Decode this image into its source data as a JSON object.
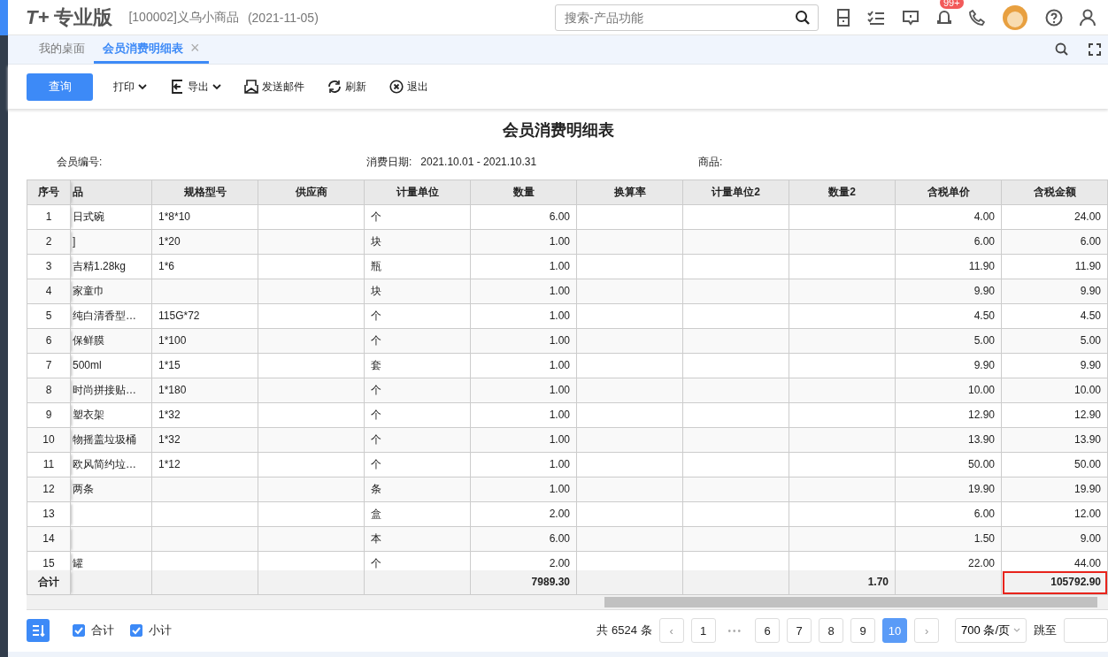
{
  "header": {
    "logo": "T+",
    "edition": "专业版",
    "company": "[100002]义乌小商品",
    "date": "(2021-11-05)",
    "search": {
      "placeholder": "搜索-产品功能"
    },
    "badge": "99+"
  },
  "tabs": [
    {
      "label": "我的桌面",
      "selected": false,
      "closable": false
    },
    {
      "label": "会员消费明细表",
      "selected": true,
      "closable": true
    }
  ],
  "close_glyph": "×",
  "toolbar": {
    "query": "查询",
    "actions": [
      {
        "kind": "print",
        "label": "打印",
        "dropdown": true
      },
      {
        "kind": "export",
        "label": "导出",
        "dropdown": true
      },
      {
        "kind": "mail",
        "label": "发送邮件",
        "dropdown": false
      },
      {
        "kind": "refresh",
        "label": "刷新",
        "dropdown": false
      },
      {
        "kind": "exit",
        "label": "退出",
        "dropdown": false
      }
    ]
  },
  "report": {
    "title": "会员消费明细表",
    "filters": [
      {
        "label": "会员编号:"
      },
      {
        "label": "消费日期:",
        "value": "2021.10.01 - 2021.10.31"
      },
      {
        "label": "商品:"
      }
    ]
  },
  "table": {
    "columns": [
      {
        "label": "序号"
      },
      {
        "label": "品"
      },
      {
        "label": "规格型号"
      },
      {
        "label": "供应商"
      },
      {
        "label": "计量单位"
      },
      {
        "label": "数量"
      },
      {
        "label": "换算率"
      },
      {
        "label": "计量单位2"
      },
      {
        "label": "数量2"
      },
      {
        "label": "含税单价"
      },
      {
        "label": "含税金额"
      }
    ],
    "rows": [
      [
        "1",
        "日式碗",
        "1*8*10",
        "",
        "个",
        "6.00",
        "",
        "",
        "",
        "4.00",
        "24.00"
      ],
      [
        "2",
        "]",
        "1*20",
        "",
        "块",
        "1.00",
        "",
        "",
        "",
        "6.00",
        "6.00"
      ],
      [
        "3",
        "吉精1.28kg",
        "1*6",
        "",
        "瓶",
        "1.00",
        "",
        "",
        "",
        "11.90",
        "11.90"
      ],
      [
        "4",
        "家童巾",
        "",
        "",
        "块",
        "1.00",
        "",
        "",
        "",
        "9.90",
        "9.90"
      ],
      [
        "5",
        "纯白清香型…",
        "115G*72",
        "",
        "个",
        "1.00",
        "",
        "",
        "",
        "4.50",
        "4.50"
      ],
      [
        "6",
        "保鲜膜",
        "1*100",
        "",
        "个",
        "1.00",
        "",
        "",
        "",
        "5.00",
        "5.00"
      ],
      [
        "7",
        "500ml",
        "1*15",
        "",
        "套",
        "1.00",
        "",
        "",
        "",
        "9.90",
        "9.90"
      ],
      [
        "8",
        "时尚拼接贴…",
        "1*180",
        "",
        "个",
        "1.00",
        "",
        "",
        "",
        "10.00",
        "10.00"
      ],
      [
        "9",
        "塑衣架",
        "1*32",
        "",
        "个",
        "1.00",
        "",
        "",
        "",
        "12.90",
        "12.90"
      ],
      [
        "10",
        "物摇盖垃圾桶",
        "1*32",
        "",
        "个",
        "1.00",
        "",
        "",
        "",
        "13.90",
        "13.90"
      ],
      [
        "11",
        "欧风简约垃…",
        "1*12",
        "",
        "个",
        "1.00",
        "",
        "",
        "",
        "50.00",
        "50.00"
      ],
      [
        "12",
        "两条",
        "",
        "",
        "条",
        "1.00",
        "",
        "",
        "",
        "19.90",
        "19.90"
      ],
      [
        "13",
        "",
        "",
        "",
        "盒",
        "2.00",
        "",
        "",
        "",
        "6.00",
        "12.00"
      ],
      [
        "14",
        "",
        "",
        "",
        "本",
        "6.00",
        "",
        "",
        "",
        "1.50",
        "9.00"
      ],
      [
        "15",
        "罐",
        "",
        "",
        "个",
        "2.00",
        "",
        "",
        "",
        "22.00",
        "44.00"
      ]
    ],
    "totals": [
      {
        "text": "合计",
        "highlighted": false
      },
      {
        "highlighted": false
      },
      {
        "highlighted": false
      },
      {
        "highlighted": false
      },
      {
        "highlighted": false
      },
      {
        "text": "7989.30",
        "highlighted": false
      },
      {
        "highlighted": false
      },
      {
        "highlighted": false
      },
      {
        "text": "1.70",
        "highlighted": false
      },
      {
        "highlighted": false
      },
      {
        "text": "105792.90",
        "highlighted": true
      }
    ]
  },
  "footer": {
    "options": [
      {
        "label": "合计",
        "checked": true
      },
      {
        "label": "小计",
        "checked": true
      }
    ],
    "total": "共 6524 条",
    "prev": "‹",
    "next": "›",
    "ellipsis": "•••",
    "pages": [
      {
        "label": "1",
        "selected": false
      },
      {
        "label": "6",
        "selected": false
      },
      {
        "label": "7",
        "selected": false
      },
      {
        "label": "8",
        "selected": false
      },
      {
        "label": "9",
        "selected": false
      },
      {
        "label": "10",
        "selected": true
      }
    ],
    "page_size": "700 条/页",
    "jump": "跳至"
  }
}
